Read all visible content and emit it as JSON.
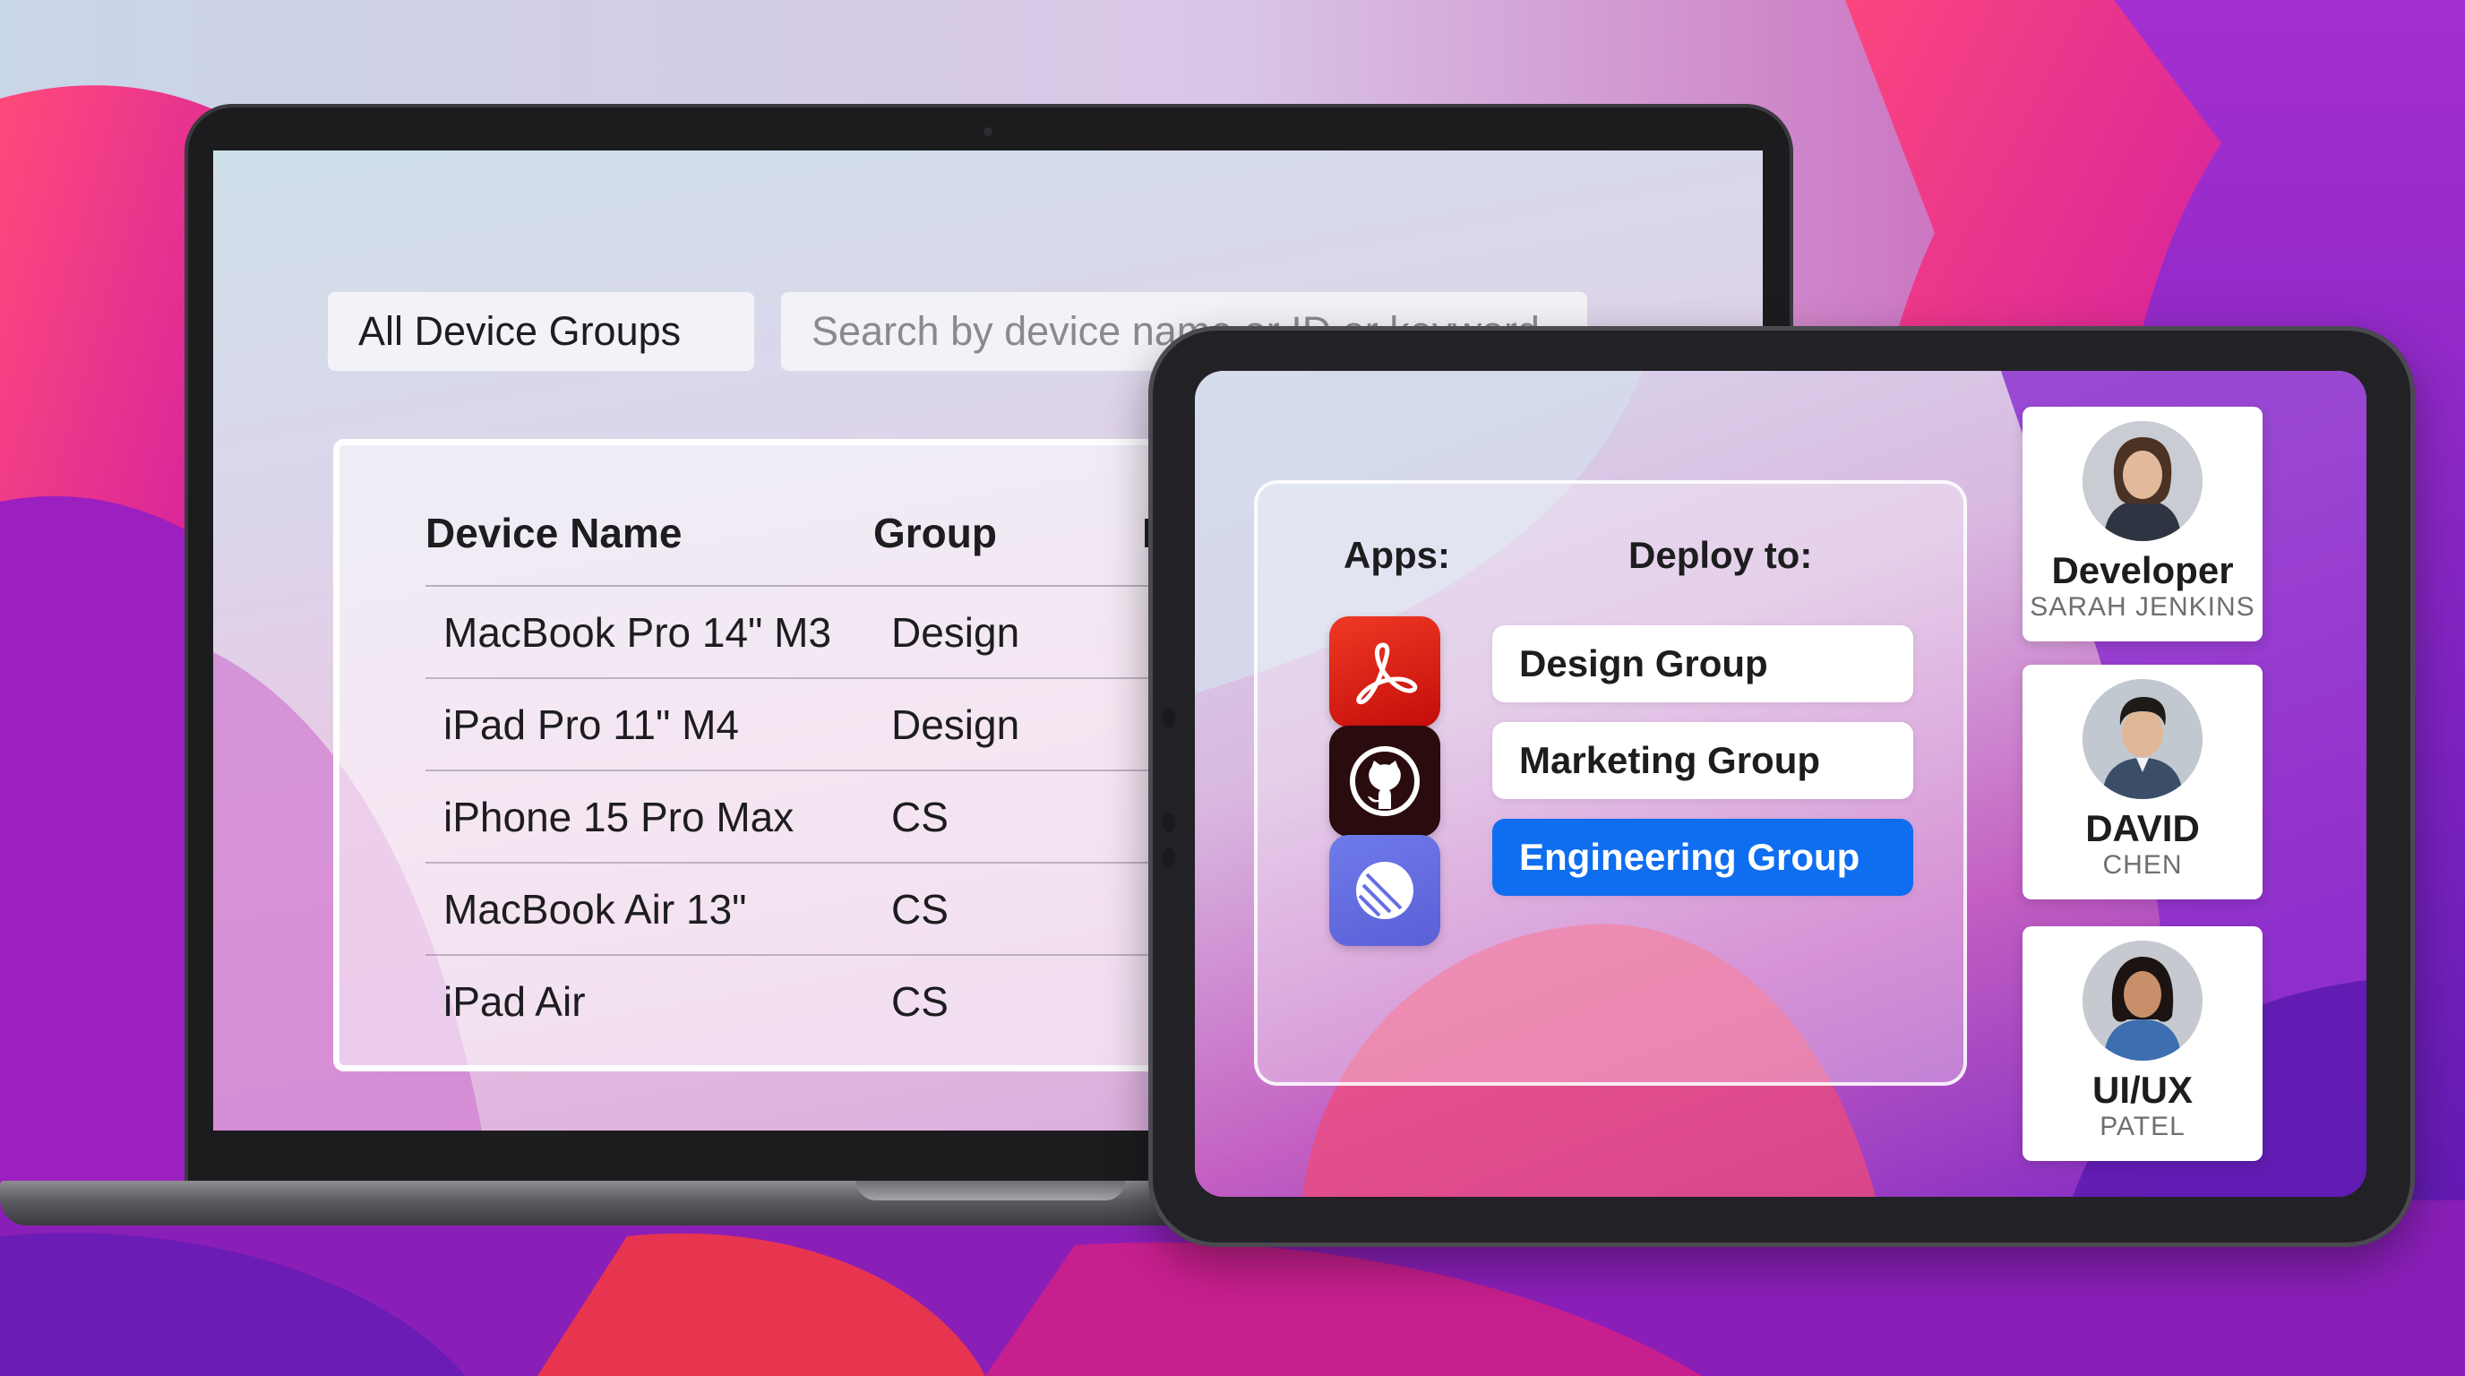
{
  "colors": {
    "accent": "#0f6ef0",
    "wallpaper_magenta": "#d31fa0",
    "wallpaper_purple": "#7a1fb8",
    "wallpaper_red": "#e8354f"
  },
  "laptop": {
    "filter": {
      "label": "All Device Groups"
    },
    "search": {
      "placeholder": "Search by device name or ID or keyword"
    },
    "table": {
      "columns": [
        "Device Name",
        "Group",
        "I"
      ],
      "rows": [
        {
          "name": "MacBook Pro 14\" M3",
          "group": "Design"
        },
        {
          "name": "iPad Pro 11\" M4",
          "group": "Design"
        },
        {
          "name": "iPhone 15 Pro Max",
          "group": "CS"
        },
        {
          "name": "MacBook Air 13\"",
          "group": "CS"
        },
        {
          "name": "iPad Air",
          "group": "CS"
        }
      ]
    }
  },
  "tablet": {
    "apps_heading": "Apps:",
    "deploy_heading": "Deploy to:",
    "apps": [
      {
        "icon": "adobe-acrobat-icon"
      },
      {
        "icon": "github-icon"
      },
      {
        "icon": "linear-icon"
      }
    ],
    "groups": [
      {
        "label": "Design Group",
        "selected": false
      },
      {
        "label": "Marketing Group",
        "selected": false
      },
      {
        "label": "Engineering Group",
        "selected": true
      }
    ],
    "users": [
      {
        "role": "Developer",
        "name": "SARAH JENKINS"
      },
      {
        "role": "DAVID",
        "name": "CHEN"
      },
      {
        "role": "UI/UX",
        "name": "PATEL"
      }
    ]
  }
}
